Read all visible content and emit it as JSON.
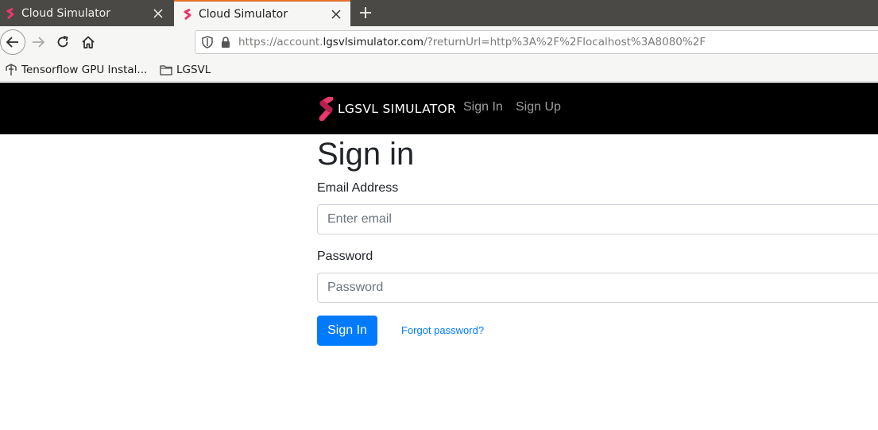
{
  "browser": {
    "tabs": [
      {
        "title": "Cloud Simulator",
        "active": false
      },
      {
        "title": "Cloud Simulator",
        "active": true
      }
    ],
    "url": {
      "prefix": "https://account.",
      "host": "lgsvlsimulator.com",
      "suffix": "/?returnUrl=http%3A%2F%2Flocalhost%3A8080%2F"
    },
    "bookmarks": [
      {
        "label": "Tensorflow GPU Instal...",
        "icon": "tensorflow-icon"
      },
      {
        "label": "LGSVL",
        "icon": "folder-icon"
      }
    ]
  },
  "site": {
    "brand": "LGSVL SIMULATOR",
    "nav": {
      "sign_in": "Sign In",
      "sign_up": "Sign Up"
    }
  },
  "form": {
    "heading": "Sign in",
    "email_label": "Email Address",
    "email_placeholder": "Enter email",
    "email_value": "",
    "password_label": "Password",
    "password_placeholder": "Password",
    "password_value": "",
    "submit_label": "Sign In",
    "forgot_label": "Forgot password?"
  },
  "colors": {
    "tabstrip": "#4a4945",
    "tab_accent": "#e5712f",
    "header_bg": "#000000",
    "brand_logo": "#e8386d",
    "primary": "#007bff",
    "nav_link": "#9d9d9d"
  }
}
